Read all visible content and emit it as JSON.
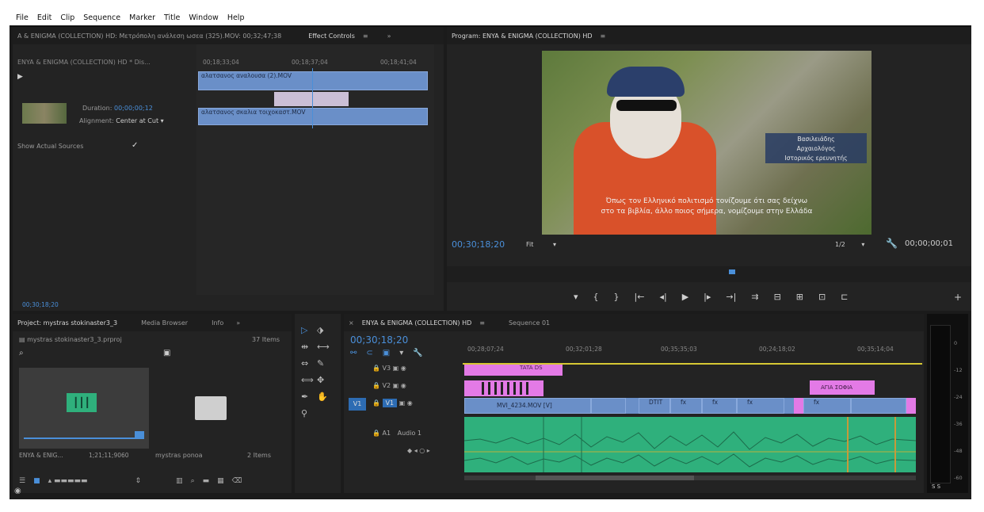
{
  "menu": [
    "File",
    "Edit",
    "Clip",
    "Sequence",
    "Marker",
    "Title",
    "Window",
    "Help"
  ],
  "effect_panel": {
    "source_tab": "A & ENIGMA (COLLECTION) HD: Μετρόπολη ανάλεση ωσεα (325).MOV: 00;32;47;38",
    "active_tab": "Effect Controls",
    "tab_menu": "≡",
    "overflow": "»",
    "seq_label": "ENYA & ENIGMA (COLLECTION) HD * Dis...",
    "duration_label": "Duration:",
    "duration_value": "00;00;00;12",
    "alignment_label": "Alignment:",
    "alignment_value": "Center at Cut",
    "show_sources_label": "Show Actual Sources",
    "check": "✓",
    "ruler": [
      "00;18;33;04",
      "00;18;37;04",
      "00;18;41;04"
    ],
    "clip_a": "αλατσανος αναλουσα (2).MOV",
    "clip_b": "αλατσανος σκαλια τοιχοκαστ.MOV",
    "timecode": "00;30;18;20"
  },
  "program": {
    "title": "Program: ENYA & ENIGMA (COLLECTION) HD",
    "tab_menu": "≡",
    "caption_name": [
      "Βασιλειάδης",
      "Αρχαιολόγος",
      "Ιστορικός ερευνητής"
    ],
    "subtitle": [
      "Όπως τον Ελληνικό πολιτισμό τονίζουμε ότι σας δείχνω",
      "στο τα βιβλία, άλλο ποιος σήμερα, νομίζουμε στην Ελλάδα"
    ],
    "timecode_left": "00;30;18;20",
    "fit": "Fit",
    "quality": "1/2",
    "timecode_right": "00;00;00;01",
    "transport": [
      "▾",
      "{",
      "}",
      "|←",
      "◂|",
      "▶",
      "|▸",
      "→|",
      "⇉",
      "⊟",
      "⊞",
      "⊡",
      "⊏"
    ]
  },
  "project": {
    "tabs": [
      "Project: mystras stokinaster3_3",
      "Media Browser",
      "Info"
    ],
    "overflow": "»",
    "tab_menu": "≡",
    "file": "mystras stokinaster3_3.prproj",
    "items_count": "37 Items",
    "item1_name": "ENYA & ENIG...",
    "item1_dur": "1;21;11;9060",
    "item2_name": "mystras ponoa",
    "item2_count": "2 Items"
  },
  "timeline": {
    "tabs": [
      "ENYA & ENIGMA (COLLECTION) HD",
      "Sequence 01"
    ],
    "tab_menu": "≡",
    "timecode": "00;30;18;20",
    "ruler": [
      "00;28;07;24",
      "00;32;01;28",
      "00;35;35;03",
      "00;24;18;02",
      "00;35;14;04"
    ],
    "tracks": [
      "V3",
      "V2",
      "V1",
      "A1"
    ],
    "source_v1": "V1",
    "audio_name": "Audio 1",
    "v3_clip": "TATA DS",
    "v2_clip": "ΑΓΙΑ ΣΟΦΙΑ",
    "v1_clip": "MVI_4234.MOV [V]",
    "v1_small": [
      "DTIT",
      "fx",
      "fx",
      "fx",
      "fx"
    ]
  },
  "meter": {
    "scale": [
      "0",
      "-12",
      "-24",
      "-36",
      "-48",
      "-60"
    ],
    "bottom": "S S"
  },
  "colors": {
    "blue": "#4a8fd9",
    "clip": "#6a8fc8",
    "audio": "#2fb07c",
    "pink": "#e37ae6",
    "yellow": "#d6c734"
  }
}
